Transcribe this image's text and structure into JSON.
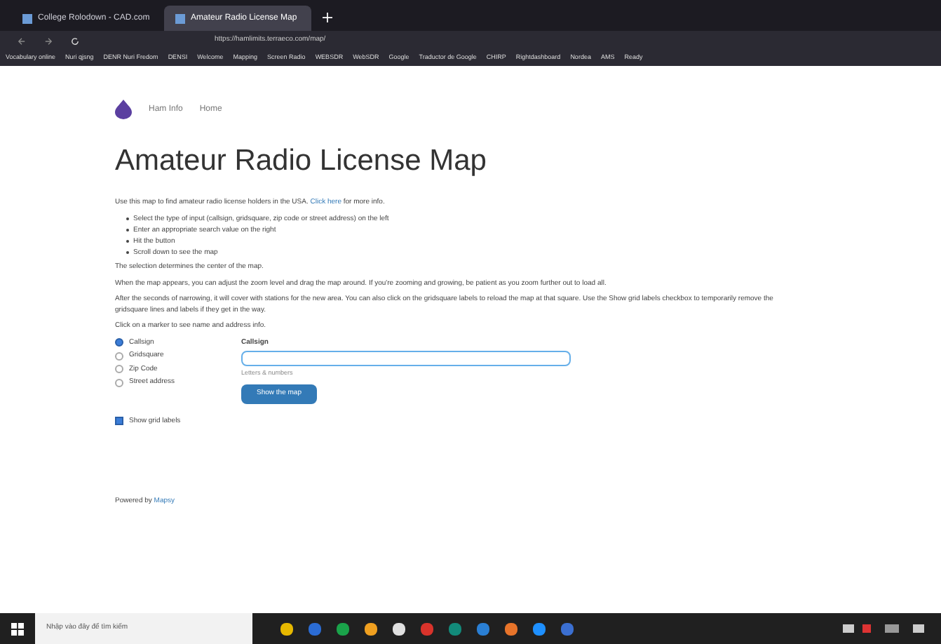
{
  "browser": {
    "tabs": [
      {
        "title": "College Rolodown - CAD.com",
        "selected": false
      },
      {
        "title": "Amateur Radio License Map",
        "selected": true
      }
    ],
    "url": "https://hamlimits.terraeco.com/map/",
    "bookmarks": [
      "Vocabulary online",
      "Nuri qjsng",
      "DENR Nuri Fredom",
      "DENSI",
      "Welcome",
      "Mapping",
      "Screen Radio",
      "WEBSDR",
      "WebSDR",
      "Google",
      "Traductor de Google",
      "CHIRP",
      "Rightdashboard",
      "Nordea",
      "AMS",
      "Ready"
    ]
  },
  "nav": {
    "items": [
      "Ham Info",
      "Home"
    ]
  },
  "title": "Amateur Radio License Map",
  "intro": "Use this map to find amateur radio license holders in the USA.",
  "intro_link": "Click here",
  "intro_after": "for more info.",
  "steps": [
    "Select the type of input (callsign, gridsquare, zip code or street address) on the left",
    "Enter an appropriate search value on the right",
    "Hit the button",
    "Scroll down to see the map"
  ],
  "paragraphs": [
    "The selection determines the center of the map.",
    "When the map appears, you can adjust the zoom level and drag the map around. If you're zooming and growing, be patient as you zoom further out to load all.",
    "After the seconds of narrowing, it will cover with stations for the new area. You can also click on the gridsquare labels to reload the map at that square. Use the Show grid labels checkbox to temporarily remove the gridsquare lines and labels if they get in the way.",
    "Click on a marker to see name and address info."
  ],
  "input_types": [
    {
      "label": "Callsign",
      "selected": true
    },
    {
      "label": "Gridsquare",
      "selected": false
    },
    {
      "label": "Zip Code",
      "selected": false
    },
    {
      "label": "Street address",
      "selected": false
    }
  ],
  "field": {
    "label": "Callsign",
    "help": "Letters & numbers"
  },
  "submit": "Show the map",
  "grid_labels": {
    "label": "Show grid labels",
    "checked": true
  },
  "footer": "Powered by",
  "footer_link": "Mapsy",
  "taskbar": {
    "search_placeholder": "Nhập vào đây để tìm kiếm"
  }
}
